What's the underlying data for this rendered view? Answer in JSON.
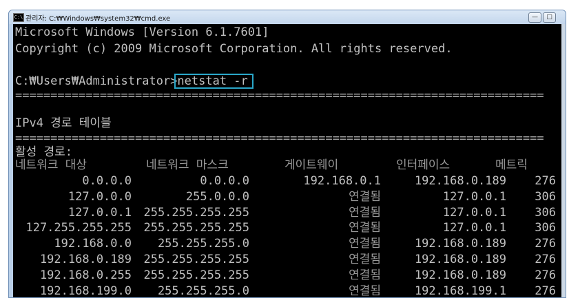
{
  "window": {
    "icon_text": "C:\\",
    "title": "관리자: C:₩Windows₩system32₩cmd.exe",
    "minimize_glyph": "—",
    "maximize_glyph": "□"
  },
  "console": {
    "lines": [
      "Microsoft Windows [Version 6.1.7601]",
      "Copyright (c) 2009 Microsoft Corporation. All rights reserved."
    ],
    "prompt": "C:₩Users₩Administrator>",
    "command": "netstat -r",
    "separator": "===========================================================================",
    "ipv4_heading": "IPv4 경로 테이블",
    "active_routes": "활성 경로:",
    "columns": [
      "네트워크 대상",
      "네트워크 마스크",
      "게이트웨이",
      "인터페이스",
      "메트릭"
    ],
    "routes": [
      {
        "dest": "0.0.0.0",
        "mask": "0.0.0.0",
        "gateway": "192.168.0.1",
        "iface": "192.168.0.189",
        "metric": "276"
      },
      {
        "dest": "127.0.0.0",
        "mask": "255.0.0.0",
        "gateway": "연결됨",
        "iface": "127.0.0.1",
        "metric": "306"
      },
      {
        "dest": "127.0.0.1",
        "mask": "255.255.255.255",
        "gateway": "연결됨",
        "iface": "127.0.0.1",
        "metric": "306"
      },
      {
        "dest": "127.255.255.255",
        "mask": "255.255.255.255",
        "gateway": "연결됨",
        "iface": "127.0.0.1",
        "metric": "306"
      },
      {
        "dest": "192.168.0.0",
        "mask": "255.255.255.0",
        "gateway": "연결됨",
        "iface": "192.168.0.189",
        "metric": "276"
      },
      {
        "dest": "192.168.0.189",
        "mask": "255.255.255.255",
        "gateway": "연결됨",
        "iface": "192.168.0.189",
        "metric": "276"
      },
      {
        "dest": "192.168.0.255",
        "mask": "255.255.255.255",
        "gateway": "연결됨",
        "iface": "192.168.0.189",
        "metric": "276"
      },
      {
        "dest": "192.168.199.0",
        "mask": "255.255.255.0",
        "gateway": "연결됨",
        "iface": "192.168.199.1",
        "metric": "276"
      }
    ]
  },
  "colors": {
    "console_bg": "#000000",
    "console_text": "#c0c0c0",
    "command_highlight": "#2aa7c9"
  }
}
